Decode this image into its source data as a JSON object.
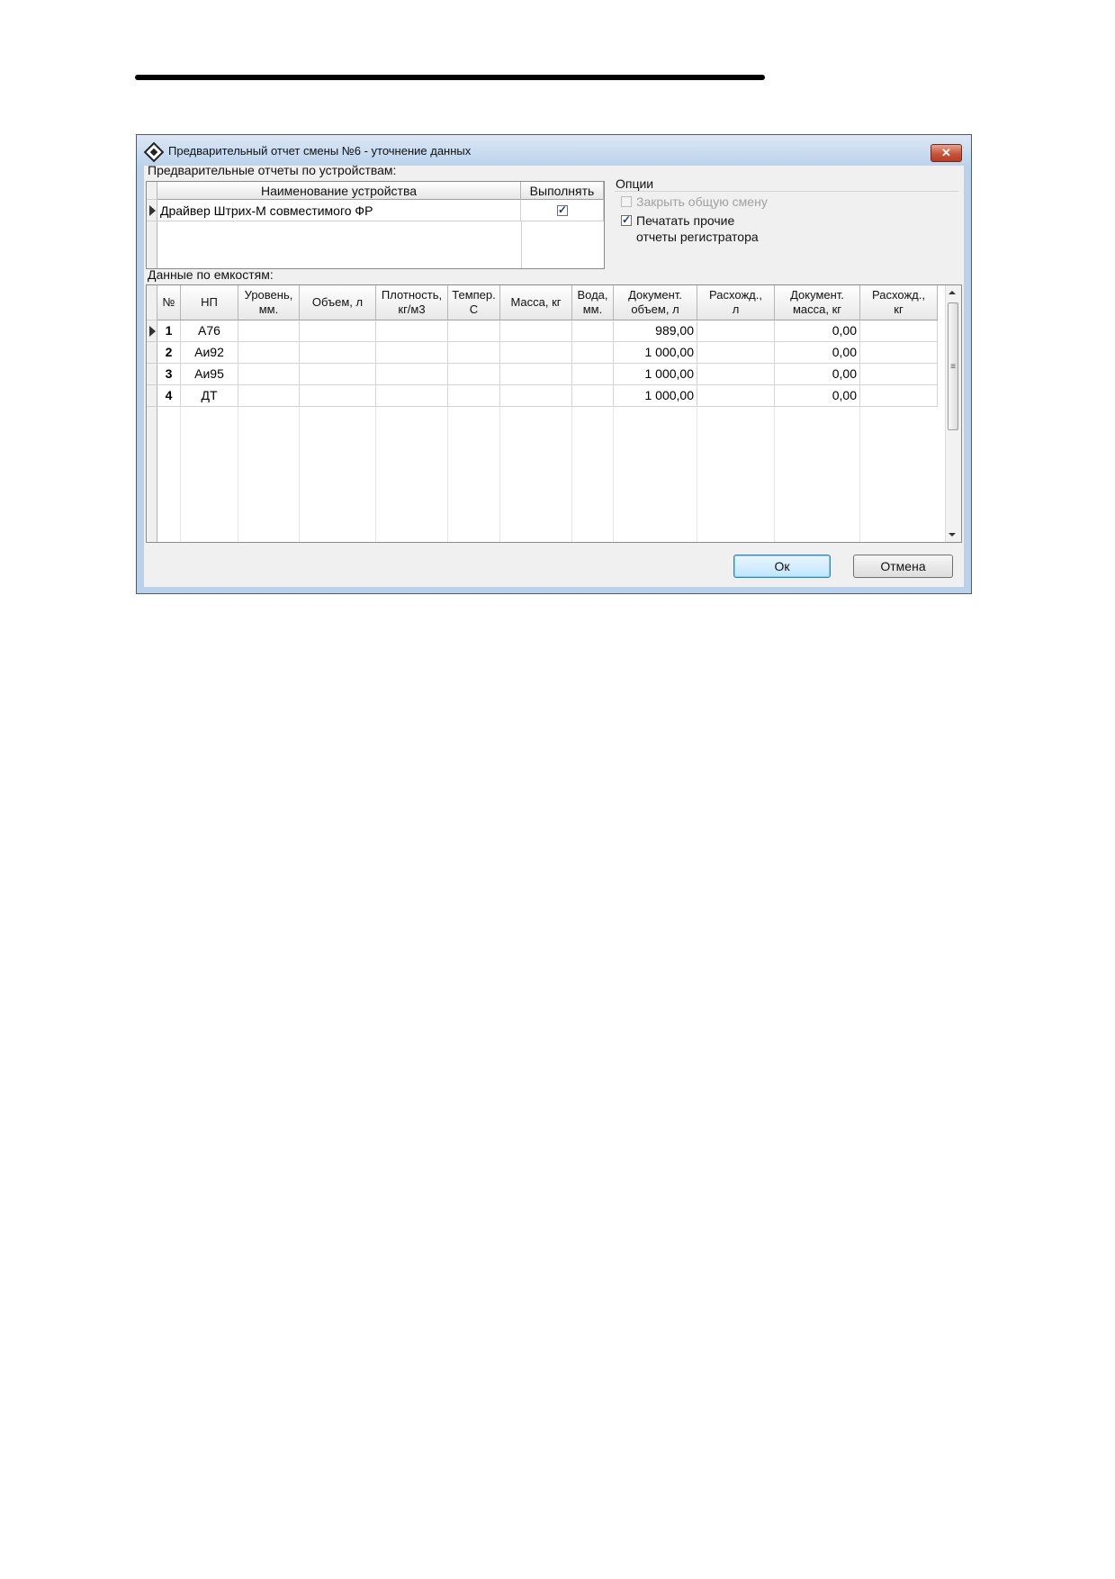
{
  "window": {
    "title": "Предварительный отчет смены №6 - уточнение данных",
    "close_symbol": "✕"
  },
  "devices": {
    "label": "Предварительные отчеты по устройствам:",
    "columns": [
      "Наименование устройства",
      "Выполнять"
    ],
    "rows": [
      {
        "name": "Драйвер Штрих-М совместимого ФР",
        "execute": true
      }
    ]
  },
  "options": {
    "label": "Опции",
    "close_shift": {
      "label": "Закрыть общую смену",
      "checked": false,
      "enabled": false
    },
    "print_other": {
      "label_line1": "Печатать прочие",
      "label_line2": "отчеты регистратора",
      "checked": true,
      "enabled": true
    }
  },
  "tanks": {
    "label": "Данные по емкостям:",
    "columns": [
      {
        "l1": "№",
        "l2": ""
      },
      {
        "l1": "НП",
        "l2": ""
      },
      {
        "l1": "Уровень,",
        "l2": "мм."
      },
      {
        "l1": "Объем, л",
        "l2": ""
      },
      {
        "l1": "Плотность,",
        "l2": "кг/м3"
      },
      {
        "l1": "Темпер.",
        "l2": "С"
      },
      {
        "l1": "Масса, кг",
        "l2": ""
      },
      {
        "l1": "Вода,",
        "l2": "мм."
      },
      {
        "l1": "Документ.",
        "l2": "объем, л"
      },
      {
        "l1": "Расхожд.,",
        "l2": "л"
      },
      {
        "l1": "Документ.",
        "l2": "масса, кг"
      },
      {
        "l1": "Расхожд.,",
        "l2": "кг"
      }
    ],
    "rows": [
      {
        "n": "1",
        "np": "А76",
        "doc_volume": "989,00",
        "doc_mass": "0,00"
      },
      {
        "n": "2",
        "np": "Аи92",
        "doc_volume": "1 000,00",
        "doc_mass": "0,00"
      },
      {
        "n": "3",
        "np": "Аи95",
        "doc_volume": "1 000,00",
        "doc_mass": "0,00"
      },
      {
        "n": "4",
        "np": "ДТ",
        "doc_volume": "1 000,00",
        "doc_mass": "0,00"
      }
    ],
    "scroll_thumb_glyph": "≡"
  },
  "buttons": {
    "ok": "Ок",
    "cancel": "Отмена"
  }
}
